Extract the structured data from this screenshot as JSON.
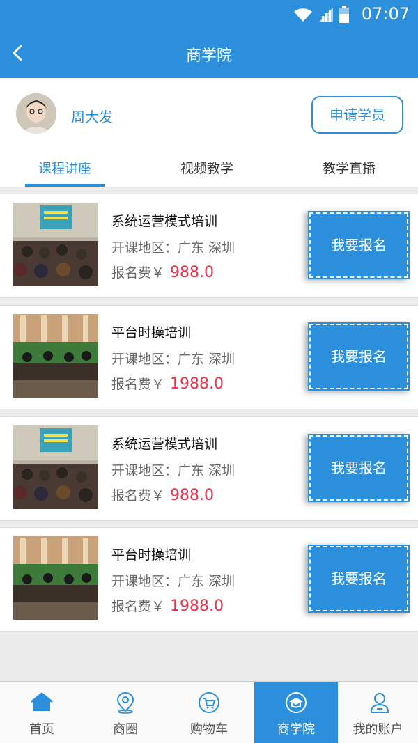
{
  "status_bar": {
    "time": "07:07"
  },
  "nav": {
    "title": "商学院"
  },
  "user": {
    "name": "周大发",
    "apply_label": "申请学员"
  },
  "tabs": [
    {
      "label": "课程讲座",
      "active": true
    },
    {
      "label": "视频教学",
      "active": false
    },
    {
      "label": "教学直播",
      "active": false
    }
  ],
  "courses": [
    {
      "title": "系统运营模式培训",
      "region_label": "开课地区：广东 深圳",
      "fee_label": "报名费￥",
      "price": "988.0",
      "signup_label": "我要报名"
    },
    {
      "title": "平台时操培训",
      "region_label": "开课地区：广东 深圳",
      "fee_label": "报名费￥",
      "price": "1988.0",
      "signup_label": "我要报名"
    },
    {
      "title": "系统运营模式培训",
      "region_label": "开课地区：广东 深圳",
      "fee_label": "报名费￥",
      "price": "988.0",
      "signup_label": "我要报名"
    },
    {
      "title": "平台时操培训",
      "region_label": "开课地区：广东 深圳",
      "fee_label": "报名费￥",
      "price": "1988.0",
      "signup_label": "我要报名"
    }
  ],
  "tabbar": [
    {
      "label": "首页",
      "icon": "home-icon",
      "active": false
    },
    {
      "label": "商圈",
      "icon": "location-pin-icon",
      "active": false
    },
    {
      "label": "购物车",
      "icon": "cart-icon",
      "active": false
    },
    {
      "label": "商学院",
      "icon": "graduation-cap-icon",
      "active": true
    },
    {
      "label": "我的账户",
      "icon": "user-icon",
      "active": false
    }
  ],
  "colors": {
    "primary": "#2b8fdc",
    "price": "#e8334a",
    "background": "#ececec"
  }
}
